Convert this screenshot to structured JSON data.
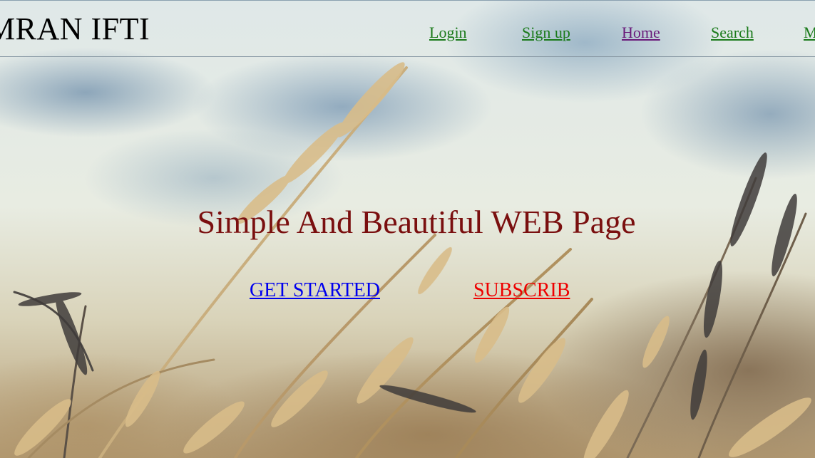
{
  "header": {
    "logo_text": "MRAN IFTI"
  },
  "nav": {
    "items": [
      {
        "label": "Login",
        "color": "#1a7a1a"
      },
      {
        "label": "Sign up",
        "color": "#1a7a1a"
      },
      {
        "label": "Home",
        "color": "#6a1a7a"
      },
      {
        "label": "Search",
        "color": "#1a7a1a"
      },
      {
        "label": "M",
        "color": "#1a7a1a"
      }
    ]
  },
  "hero": {
    "title": "Simple And Beautiful WEB Page",
    "primary_cta": "GET STARTED",
    "secondary_cta": "SUBSCRIB",
    "title_color": "#7a0f0f",
    "primary_cta_color": "#0000ee",
    "secondary_cta_color": "#ee0000",
    "background_image": "wheat-field-sky"
  }
}
